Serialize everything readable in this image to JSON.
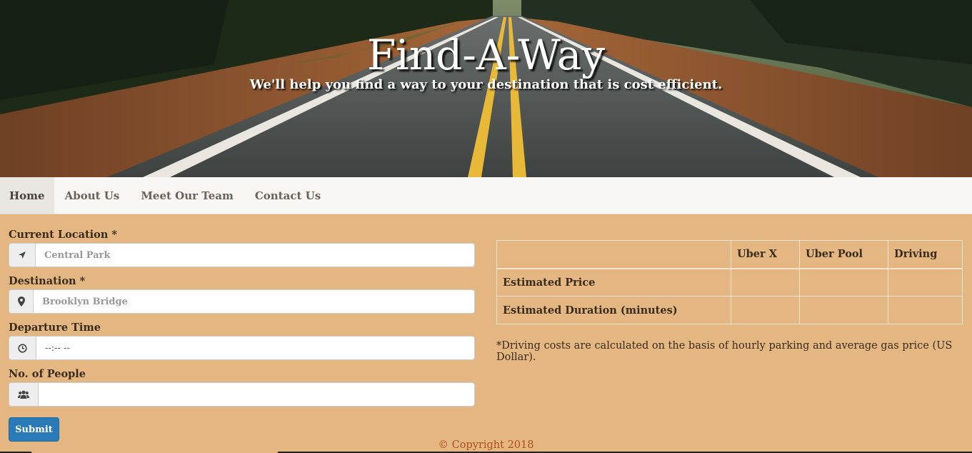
{
  "hero": {
    "title": "Find-A-Way",
    "subtitle": "We'll help you find a way to your destination that is cost efficient."
  },
  "nav": {
    "items": [
      {
        "label": "Home",
        "active": true
      },
      {
        "label": "About Us",
        "active": false
      },
      {
        "label": "Meet Our Team",
        "active": false
      },
      {
        "label": "Contact Us",
        "active": false
      }
    ]
  },
  "form": {
    "current_location": {
      "label": "Current Location *",
      "placeholder": "Central Park",
      "icon": "location-arrow-icon"
    },
    "destination": {
      "label": "Destination *",
      "placeholder": "Brooklyn Bridge",
      "icon": "map-marker-icon"
    },
    "departure_time": {
      "label": "Departure Time",
      "value": "--:-- --",
      "icon": "clock-icon"
    },
    "people": {
      "label": "No. of People",
      "value": "",
      "icon": "users-icon"
    },
    "submit_label": "Submit"
  },
  "table": {
    "headers": [
      "",
      "Uber X",
      "Uber Pool",
      "Driving"
    ],
    "rows": [
      {
        "label": "Estimated Price",
        "values": [
          "",
          "",
          ""
        ]
      },
      {
        "label": "Estimated Duration (minutes)",
        "values": [
          "",
          "",
          ""
        ]
      }
    ],
    "note": "*Driving costs are calculated on the basis of hourly parking and average gas price (US Dollar)."
  },
  "footer": {
    "copyright": "© Copyright 2018"
  },
  "colors": {
    "page_bg": "#e4b782",
    "nav_bg": "#f8f7f5",
    "button_bg": "#2a7ab8",
    "copyright": "#b34c1e"
  }
}
